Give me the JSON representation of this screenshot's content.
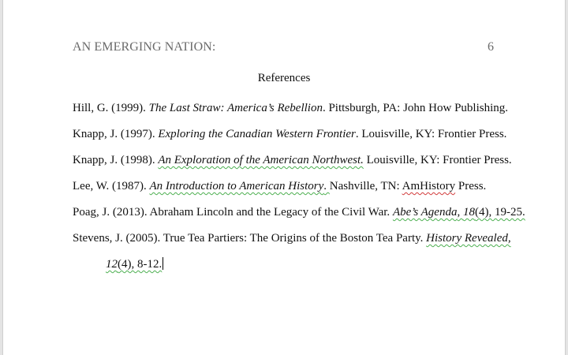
{
  "document": {
    "running_head": "AN EMERGING NATION:",
    "page_number": "6",
    "heading": "References"
  },
  "references": [
    {
      "author": "Hill, G. (1999). ",
      "title": "The Last Straw: America’s Rebellion",
      "rest": ". Pittsburgh, PA: John How Publishing."
    },
    {
      "author": "Knapp, J. (1997). ",
      "title": "Exploring the Canadian Western Frontier",
      "rest": ". Louisville, KY: Frontier Press."
    },
    {
      "author": "Knapp, J. (1998). ",
      "title": "An Exploration of the American Northwest.",
      "rest": " Louisville, KY: Frontier Press."
    },
    {
      "author": "Lee, W. (1987). ",
      "title": "An Introduction to American History",
      "sep": ". ",
      "rest_pre": "Nashville, TN: ",
      "publisher_word": "AmHistory",
      "rest_post": " Press."
    },
    {
      "author": "Poag, J. (2013). Abraham Lincoln and the Legacy of the Civil War. ",
      "journal": "Abe’s Agenda",
      "comma": ", ",
      "volume": "18",
      "issue": "(4), 19-25."
    },
    {
      "author": "Stevens, J. (2005). True Tea Partiers: The Origins of the Boston Tea Party. ",
      "journal": "History Revealed,",
      "volume": "12",
      "issue": "(4), 8-12."
    }
  ]
}
